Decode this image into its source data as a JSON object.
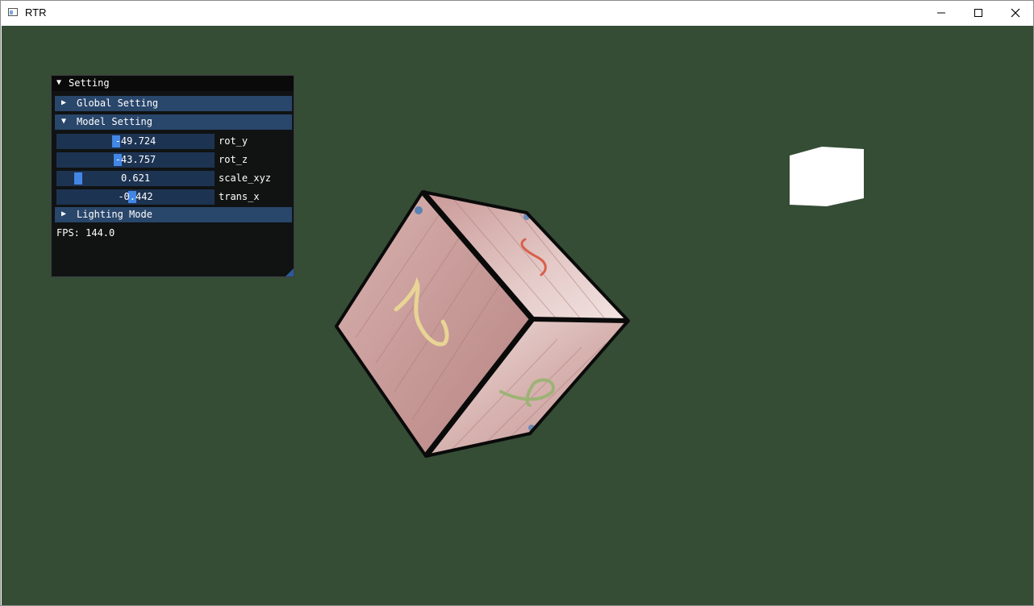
{
  "window": {
    "title": "RTR"
  },
  "panel": {
    "title": "Setting",
    "sections": {
      "global": "Global Setting",
      "model": "Model Setting",
      "lighting": "Lighting Mode"
    },
    "sliders": [
      {
        "label": "rot_y",
        "value": "-49.724",
        "fraction": 0.37
      },
      {
        "label": "rot_z",
        "value": "-43.757",
        "fraction": 0.38
      },
      {
        "label": "scale_xyz",
        "value": "0.621",
        "fraction": 0.11
      },
      {
        "label": "trans_x",
        "value": "-0.442",
        "fraction": 0.48
      }
    ],
    "fps": "FPS: 144.0"
  },
  "colors": {
    "background": "#354c35",
    "panel_bg": "#101312",
    "header_bg": "#29466b",
    "slider_bg": "#1d3352",
    "slider_grab": "#4287e6",
    "light_cube": "#ffffff"
  },
  "icons": [
    "app-icon",
    "minimize-icon",
    "maximize-icon",
    "close-icon",
    "collapse-arrow-icon",
    "expand-arrow-icon"
  ]
}
